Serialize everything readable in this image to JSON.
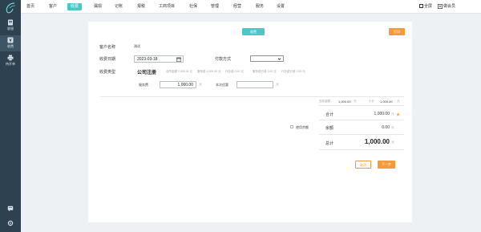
{
  "sidebar": {
    "items": [
      {
        "label": "收银",
        "icon": "receipt-icon"
      },
      {
        "label": "收费",
        "icon": "fee-icon"
      },
      {
        "label": "待开单",
        "icon": "printer-icon"
      }
    ],
    "bottom_icons": [
      "message-icon",
      "settings-icon"
    ]
  },
  "topnav": {
    "items": [
      "首页",
      "客户",
      "收费",
      "漏损",
      "记账",
      "报税",
      "工商项目",
      "社保",
      "管理",
      "经营",
      "服务",
      "设置"
    ],
    "active": "收费",
    "fullscreen_label": "全屏",
    "member_label": "做会员"
  },
  "form": {
    "title": "收费",
    "print_label": "打印",
    "customer_label": "客户名称",
    "customer_value": "测试",
    "date_label": "收费日期",
    "date_value": "2023-03-18",
    "payment_label": "付款方式",
    "payment_value": "",
    "fee_type_label": "收费类型",
    "fee_type_value": "公司注册",
    "fee_notes": [
      "合同金额 1,000.00 元",
      "服务费 1,000.00 元",
      "代办费 0.00 元",
      "服务费已收 0.00 元",
      "代办费已收 0.00 元"
    ],
    "service_fee_label": "服务费",
    "service_fee_value": "1,000.00",
    "discount_label": "本次优惠",
    "discount_value": "",
    "unit": "元"
  },
  "summary": {
    "receivable_label": "应收金额",
    "receivable_value": "1,000.00",
    "subtotal_label": "小计",
    "subtotal_value": "1,000.00",
    "total_label": "合计",
    "total_value": "1,000.00",
    "use_balance_label": "使用余额",
    "balance_label": "余额",
    "balance_value": "0.00",
    "grand_label": "总计",
    "grand_value": "1,000.00",
    "unit": "元"
  },
  "actions": {
    "cancel_label": "取消",
    "next_label": "下一步"
  },
  "colors": {
    "accent": "#4ac7c7",
    "orange": "#f39a3b",
    "sidebar": "#2e4150"
  }
}
